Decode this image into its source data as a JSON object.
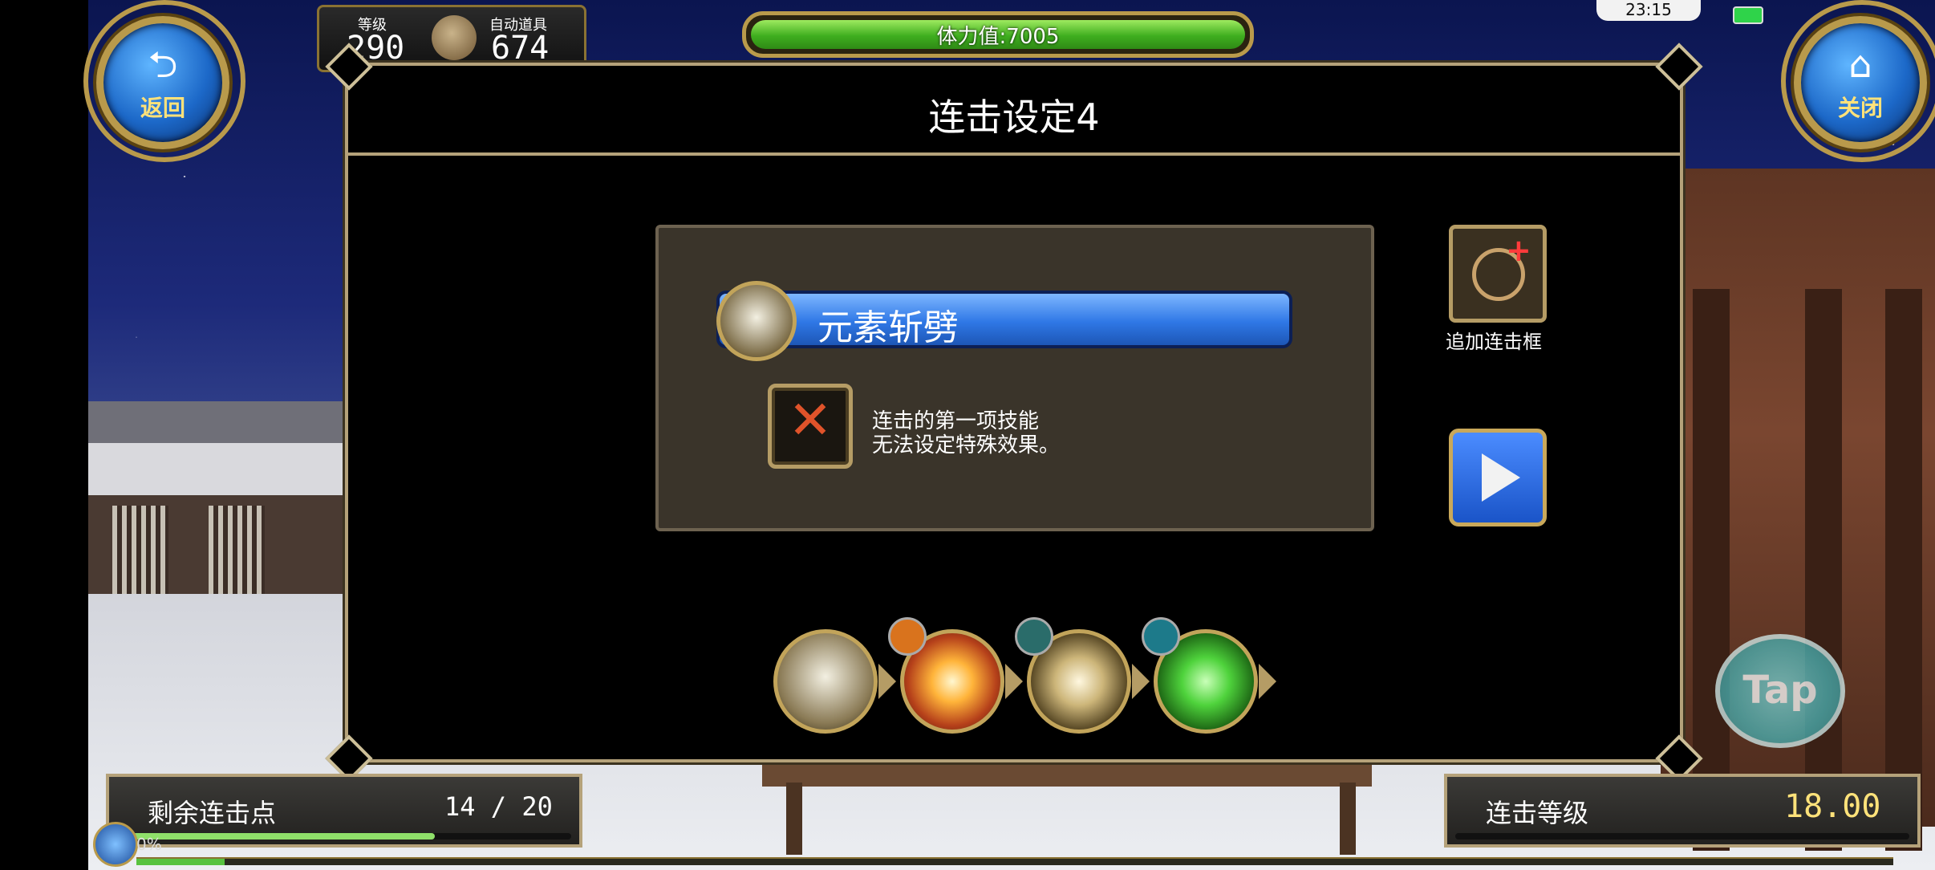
{
  "hud": {
    "back_label": "返回",
    "close_label": "关闭",
    "level_label": "等级",
    "level_value": "290",
    "auto_item_label": "自动道具",
    "auto_item_value": "674",
    "stamina_text": "体力值:7005",
    "time": "23:15",
    "exp_percent": "0%",
    "exp_progress": 0.05
  },
  "dialog": {
    "title": "连击设定4",
    "skill_name": "元素斩劈",
    "notice_line1": "连击的第一项技能",
    "notice_line2": "无法设定特殊效果。",
    "add_frame_label": "追加连击框",
    "combo_skills": [
      {
        "icon": "slash-skill-icon",
        "badge": ""
      },
      {
        "icon": "burst-skill-icon",
        "badge": "fist-badge-icon"
      },
      {
        "icon": "barrier-skill-icon",
        "badge": "potion-badge-icon"
      },
      {
        "icon": "body-skill-icon",
        "badge": "figure-badge-icon"
      }
    ]
  },
  "bottom": {
    "remaining_label": "剩余连击点",
    "remaining_value": "14 / 20",
    "remaining_progress": 0.7,
    "combo_level_label": "连击等级",
    "combo_level_value": "18.00",
    "tap_label": "Tap"
  },
  "colors": {
    "gold": "#b99a4b",
    "skill_blue": "#2f78e6",
    "stamina_green": "#3fae1f",
    "combo_level_yellow": "#ffe27a"
  }
}
